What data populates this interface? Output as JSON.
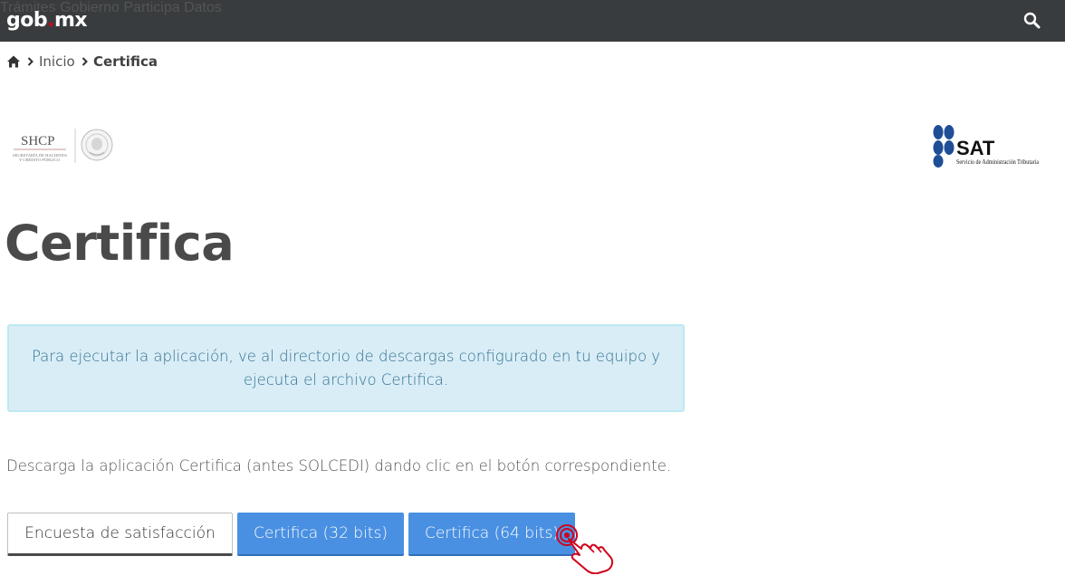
{
  "header": {
    "brand_left": "gob",
    "brand_dot": ".",
    "brand_right": "mx",
    "nav": [
      {
        "label": "Trámites"
      },
      {
        "label": "Gobierno"
      },
      {
        "label": "Participa"
      },
      {
        "label": "Datos"
      }
    ],
    "search_icon": "search-icon"
  },
  "breadcrumb": {
    "home_icon": "home-icon",
    "items": [
      {
        "label": "Inicio"
      },
      {
        "label": "Certifica"
      }
    ]
  },
  "logos": {
    "shcp_abbr": "SHCP",
    "shcp_line1": "SECRETARÍA DE HACIENDA",
    "shcp_line2": "Y CRÉDITO PÚBLICO",
    "sat_abbr": "SAT",
    "sat_name": "Servicio de Administración Tributaria"
  },
  "page": {
    "title": "Certifica",
    "info_text": "Para ejecutar la aplicación, ve al directorio de descargas configurado en tu equipo y ejecuta el archivo Certifica.",
    "description": "Descarga la aplicación Certifica (antes SOLCEDI) dando clic en el botón correspondiente."
  },
  "buttons": {
    "survey": "Encuesta de satisfacción",
    "download_32": "Certifica (32 bits)",
    "download_64": "Certifica (64 bits)"
  },
  "colors": {
    "topbar": "#393c3e",
    "brand_dot": "#d0021b",
    "info_bg": "#d9edf7",
    "info_border": "#bce8f1",
    "info_text": "#31708f",
    "primary": "#4a90e2",
    "cursor": "#d0021b"
  }
}
